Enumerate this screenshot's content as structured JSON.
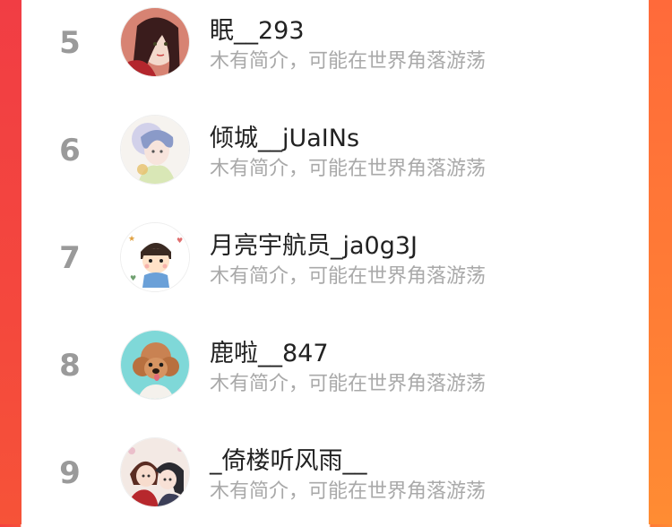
{
  "ranking": {
    "items": [
      {
        "rank": "5",
        "name": "眠__293",
        "bio": "木有简介，可能在世界角落游荡",
        "avatar_icon": "anime-girl-red-avatar"
      },
      {
        "rank": "6",
        "name": "倾城__jUaINs",
        "bio": "木有简介，可能在世界角落游荡",
        "avatar_icon": "anime-girl-watercolor-avatar"
      },
      {
        "rank": "7",
        "name": "月亮宇航员_ja0g3J",
        "bio": "木有简介，可能在世界角落游荡",
        "avatar_icon": "cartoon-boy-avatar"
      },
      {
        "rank": "8",
        "name": "鹿啦__847",
        "bio": "木有简介，可能在世界角落游荡",
        "avatar_icon": "poodle-dog-avatar"
      },
      {
        "rank": "9",
        "name": "_倚楼听风雨__",
        "bio": "木有简介，可能在世界角落游荡",
        "avatar_icon": "anime-couple-avatar"
      }
    ]
  },
  "colors": {
    "left_edge": "#f4403f",
    "right_edge": "#ff7d35",
    "rank_text": "#9a9a9a",
    "name_text": "#222222",
    "bio_text": "#a9a9a9"
  }
}
